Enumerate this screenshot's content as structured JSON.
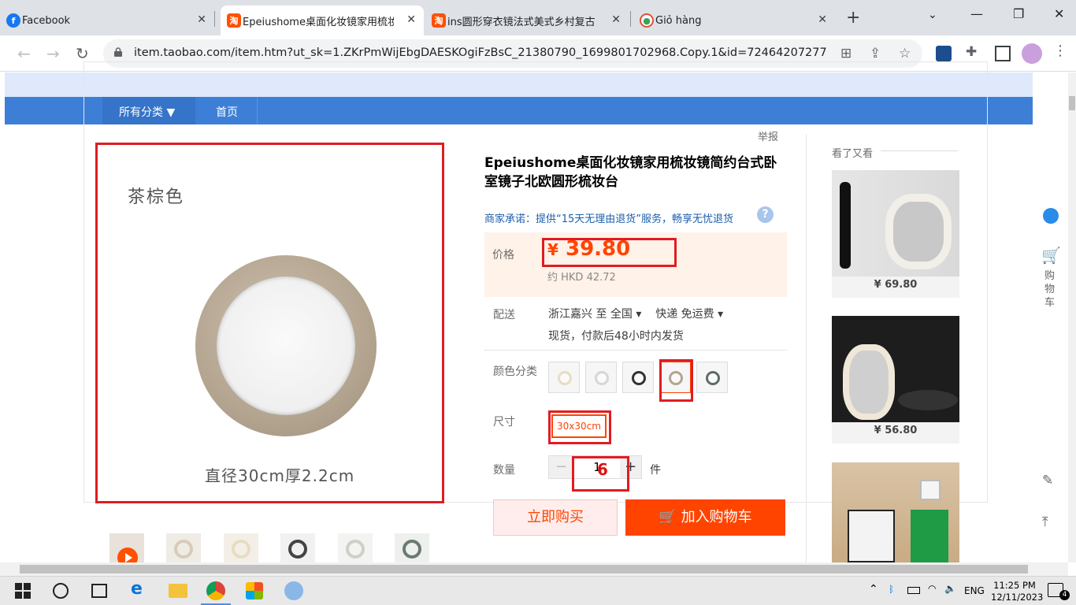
{
  "browser": {
    "tabs": [
      {
        "title": "Facebook",
        "active": false
      },
      {
        "title": "Epeiushome桌面化妆镜家用梳妆",
        "active": true
      },
      {
        "title": "ins圆形穿衣镜法式美式乡村复古",
        "active": false
      },
      {
        "title": "Giỏ hàng",
        "active": false
      }
    ],
    "url": "item.taobao.com/item.htm?ut_sk=1.ZKrPmWijEbgDAESKOgiFzBsC_21380790_1699801702968.Copy.1&id=72464207277..."
  },
  "nav": {
    "categories": "所有分类 ▼",
    "home": "首页"
  },
  "report": "举报",
  "main_image": {
    "tag": "茶棕色",
    "caption": "直径30cm厚2.2cm"
  },
  "product": {
    "title": "Epeiushome桌面化妆镜家用梳妆镜简约台式卧室镜子北欧圆形梳妆台",
    "promise": "商家承诺：提供“15天无理由退货”服务，畅享无忧退货",
    "price_label": "价格",
    "currency": "¥",
    "price": "39.80",
    "price_hkd": "约 HKD 42.72",
    "shipping_label": "配送",
    "shipping_from": "浙江嘉兴 至",
    "shipping_to": "全国 ▾",
    "shipping_method": "快递 免运费 ▾",
    "stock_note": "现货，付款后48小时内发货",
    "color_label": "颜色分类",
    "size_label": "尺寸",
    "size_value": "30x30cm",
    "quantity_label": "数量",
    "quantity_value": "1",
    "quantity_overlay": "6",
    "quantity_unit": "件",
    "minus": "−",
    "plus": "+",
    "buy_now": "立即购买",
    "add_to_cart": "加入购物车"
  },
  "recommend": {
    "title": "看了又看",
    "items": [
      {
        "price": "¥ 69.80"
      },
      {
        "price": "¥ 56.80"
      },
      {
        "price": ""
      }
    ]
  },
  "sidebar": {
    "cart": "购物车"
  },
  "taskbar": {
    "language": "ENG",
    "time": "11:25 PM",
    "date": "12/11/2023",
    "notifications": "4"
  },
  "colors": {
    "accent": "#ff4400",
    "nav_blue": "#3d7fd6",
    "annotation_red": "#e01c23"
  }
}
